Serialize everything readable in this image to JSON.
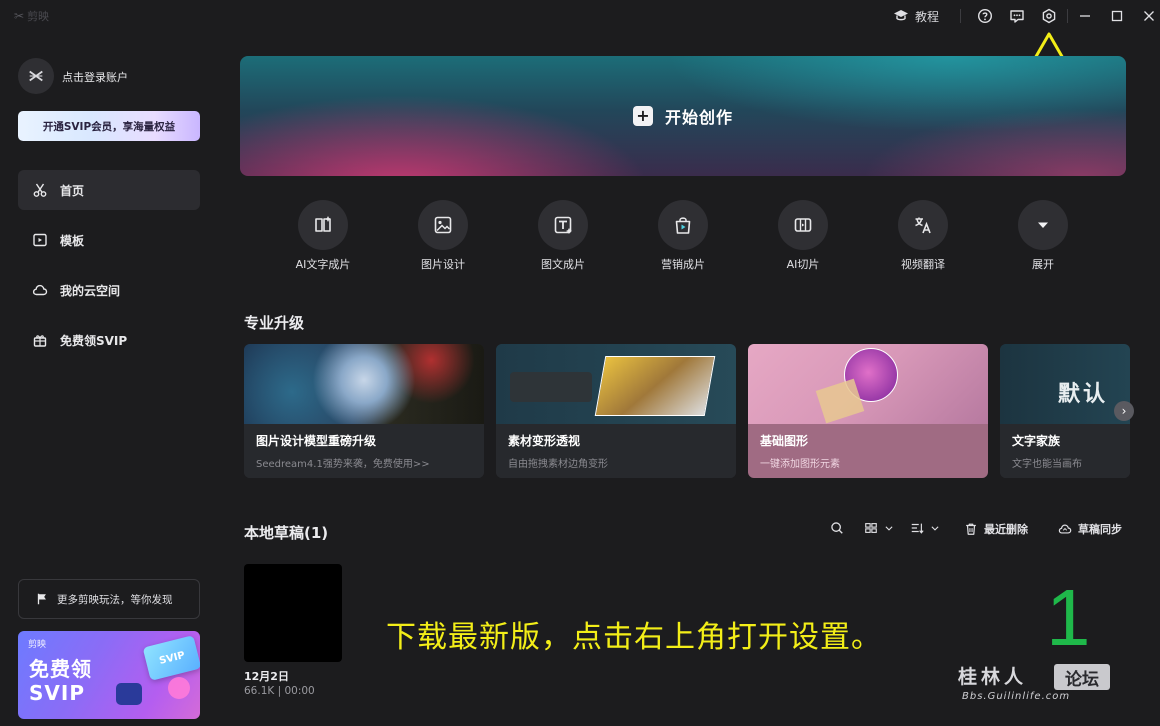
{
  "titlebar": {
    "app_name": "剪映",
    "tutorial_label": "教程"
  },
  "sidebar": {
    "login_label": "点击登录账户",
    "svip_button": "开通SVIP会员，享海量权益",
    "nav": [
      {
        "label": "首页",
        "icon": "scissors-icon"
      },
      {
        "label": "模板",
        "icon": "template-icon"
      },
      {
        "label": "我的云空间",
        "icon": "cloud-icon"
      },
      {
        "label": "免费领SVIP",
        "icon": "gift-icon"
      }
    ],
    "more_label": "更多剪映玩法，等你发现",
    "promo": {
      "logo": "剪映",
      "line1": "免费领",
      "line2": "SVIP",
      "card": "SVIP"
    }
  },
  "hero": {
    "label": "开始创作"
  },
  "tools": [
    {
      "label": "AI文字成片",
      "icon": "ai-text-video-icon"
    },
    {
      "label": "图片设计",
      "icon": "image-design-icon"
    },
    {
      "label": "图文成片",
      "icon": "text-image-video-icon"
    },
    {
      "label": "营销成片",
      "icon": "marketing-bag-icon"
    },
    {
      "label": "AI切片",
      "icon": "ai-clip-icon"
    },
    {
      "label": "视频翻译",
      "icon": "translate-icon"
    },
    {
      "label": "展开",
      "icon": "expand-chevron-icon"
    }
  ],
  "upgrade": {
    "title": "专业升级",
    "cards": [
      {
        "title": "图片设计模型重磅升级",
        "subtitle": "Seedream4.1强势来袭，免费使用>>"
      },
      {
        "title": "素材变形透视",
        "subtitle": "自由拖拽素材边角变形"
      },
      {
        "title": "基础图形",
        "subtitle": "一键添加图形元素"
      },
      {
        "title": "文字家族",
        "subtitle": "文字也能当画布"
      }
    ],
    "card4_image_text": "默认"
  },
  "drafts": {
    "title": "本地草稿(1)",
    "recent_delete": "最近删除",
    "sync": "草稿同步",
    "items": [
      {
        "date": "12月2日",
        "meta": "66.1K | 00:00"
      }
    ]
  },
  "annotation": {
    "text": "下载最新版，点击右上角打开设置。",
    "number": "1"
  },
  "watermark": {
    "line1": "桂林人",
    "box": "论坛",
    "url": "Bbs.Guilinlife.com"
  },
  "colors": {
    "background": "#1c1c1e",
    "annotation_yellow": "#f3ee18",
    "annotation_green": "#1fb84a"
  }
}
